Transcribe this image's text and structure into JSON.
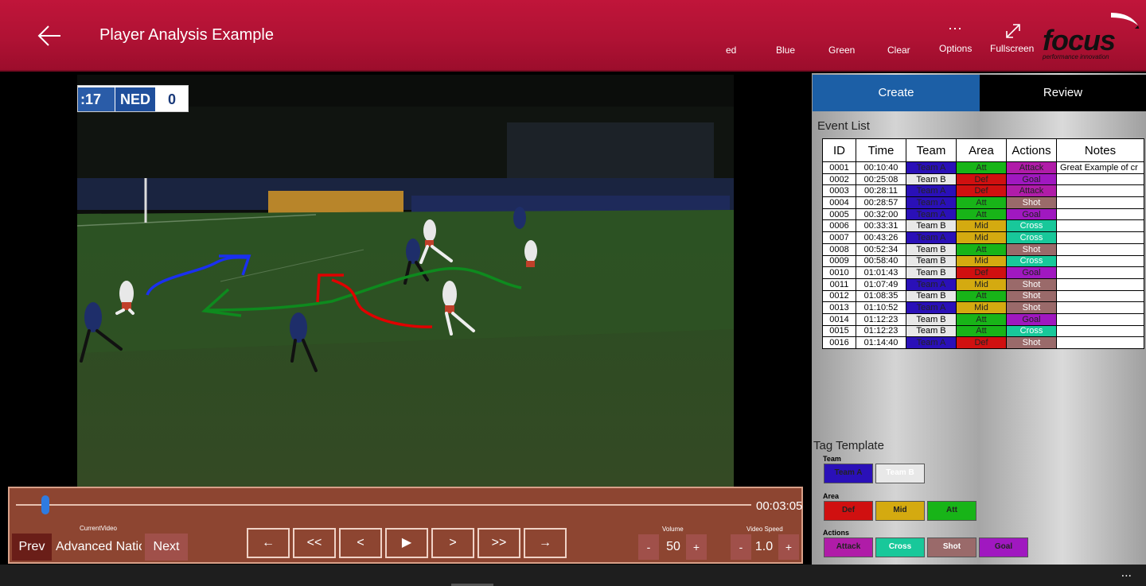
{
  "header": {
    "title": "Player Analysis Example",
    "back_icon": "arrow-left-icon",
    "colors": [
      "ed",
      "Blue",
      "Green",
      "Clear"
    ],
    "options_label": "Options",
    "fullscreen_label": "Fullscreen",
    "logo_word": "focus",
    "logo_tagline": "performance innovation"
  },
  "scoreboard": {
    "time": ":17",
    "team": "NED",
    "score": "0"
  },
  "player": {
    "duration": "00:03:05",
    "progress": 0.04,
    "current_video_label": "CurrentVideo",
    "current_video_name": "Advanced Nation",
    "prev_label": "Prev",
    "next_label": "Next",
    "transport": [
      "←",
      "<<",
      "<",
      "▶",
      ">",
      ">>",
      "→"
    ],
    "volume_label": "Volume",
    "volume": "50",
    "speed_label": "Video Speed",
    "speed": "1.0",
    "minus": "-",
    "plus": "+"
  },
  "panel": {
    "tabs": [
      "Create",
      "Review"
    ],
    "event_list_title": "Event List",
    "columns": [
      "ID",
      "Time",
      "Team",
      "Area",
      "Actions",
      "Notes"
    ],
    "events": [
      {
        "id": "0001",
        "time": "00:10:40",
        "team": "Team A",
        "area": "Att",
        "action": "Attack",
        "note": "Great Example of cr"
      },
      {
        "id": "0002",
        "time": "00:25:08",
        "team": "Team B",
        "area": "Def",
        "action": "Goal",
        "note": ""
      },
      {
        "id": "0003",
        "time": "00:28:11",
        "team": "Team A",
        "area": "Def",
        "action": "Attack",
        "note": ""
      },
      {
        "id": "0004",
        "time": "00:28:57",
        "team": "Team A",
        "area": "Att",
        "action": "Shot",
        "note": ""
      },
      {
        "id": "0005",
        "time": "00:32:00",
        "team": "Team A",
        "area": "Att",
        "action": "Goal",
        "note": ""
      },
      {
        "id": "0006",
        "time": "00:33:31",
        "team": "Team B",
        "area": "Mid",
        "action": "Cross",
        "note": ""
      },
      {
        "id": "0007",
        "time": "00:43:26",
        "team": "Team A",
        "area": "Mid",
        "action": "Cross",
        "note": ""
      },
      {
        "id": "0008",
        "time": "00:52:34",
        "team": "Team B",
        "area": "Att",
        "action": "Shot",
        "note": ""
      },
      {
        "id": "0009",
        "time": "00:58:40",
        "team": "Team B",
        "area": "Mid",
        "action": "Cross",
        "note": ""
      },
      {
        "id": "0010",
        "time": "01:01:43",
        "team": "Team B",
        "area": "Def",
        "action": "Goal",
        "note": ""
      },
      {
        "id": "0011",
        "time": "01:07:49",
        "team": "Team A",
        "area": "Mid",
        "action": "Shot",
        "note": ""
      },
      {
        "id": "0012",
        "time": "01:08:35",
        "team": "Team B",
        "area": "Att",
        "action": "Shot",
        "note": ""
      },
      {
        "id": "0013",
        "time": "01:10:52",
        "team": "Team A",
        "area": "Mid",
        "action": "Shot",
        "note": ""
      },
      {
        "id": "0014",
        "time": "01:12:23",
        "team": "Team B",
        "area": "Att",
        "action": "Goal",
        "note": ""
      },
      {
        "id": "0015",
        "time": "01:12:23",
        "team": "Team B",
        "area": "Att",
        "action": "Cross",
        "note": ""
      },
      {
        "id": "0016",
        "time": "01:14:40",
        "team": "Team A",
        "area": "Def",
        "action": "Shot",
        "note": ""
      }
    ],
    "tag_template_title": "Tag Template",
    "tag_groups": [
      {
        "name": "Team",
        "tags": [
          "Team A",
          "Team B"
        ]
      },
      {
        "name": "Area",
        "tags": [
          "Def",
          "Mid",
          "Att"
        ]
      },
      {
        "name": "Actions",
        "tags": [
          "Attack",
          "Cross",
          "Shot",
          "Goal"
        ]
      }
    ],
    "tag_colors": {
      "Team A": "#2a10b8",
      "Team B": "#e8e8e8",
      "Def": "#d01010",
      "Mid": "#d4aa10",
      "Att": "#18b418",
      "Attack": "#b01ca8",
      "Cross": "#18c89a",
      "Shot": "#9a6a6a",
      "Goal": "#a018c0"
    }
  },
  "taskbar": {
    "more": "..."
  }
}
